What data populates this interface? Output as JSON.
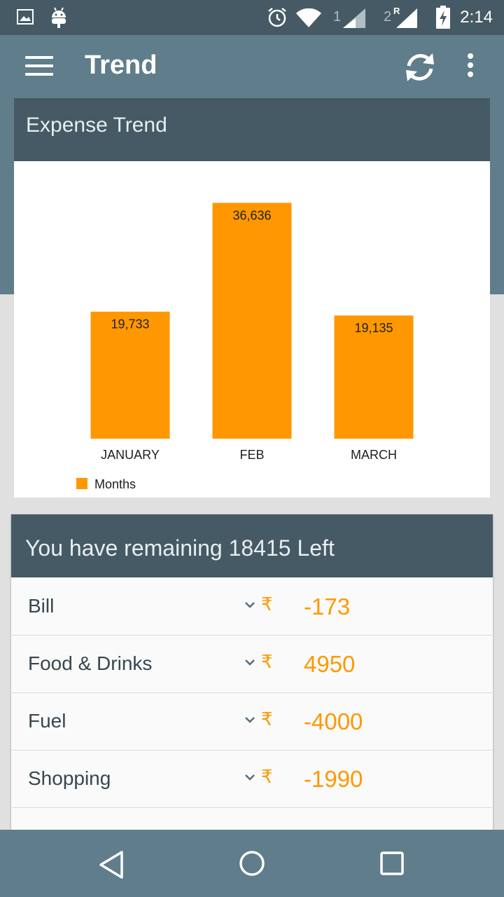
{
  "status_bar": {
    "time": "2:14",
    "sim1_label": "1",
    "sim2_label": "2",
    "sim2_roaming": "R",
    "icons": [
      "image-icon",
      "android-icon",
      "alarm-icon",
      "wifi-icon",
      "signal-icon",
      "signal-icon",
      "battery-charging-icon"
    ]
  },
  "app_bar": {
    "title": "Trend",
    "menu_icon": "hamburger-menu-icon",
    "refresh_icon": "refresh-icon",
    "more_icon": "more-vert-icon"
  },
  "trend_card": {
    "title": "Expense Trend"
  },
  "chart_data": {
    "type": "bar",
    "categories": [
      "JANUARY",
      "FEB",
      "MARCH"
    ],
    "values": [
      19733,
      36636,
      19135
    ],
    "value_labels": [
      "19,733",
      "36,636",
      "19,135"
    ],
    "series": [
      {
        "name": "Months",
        "values": [
          19733,
          36636,
          19135
        ]
      }
    ],
    "legend": "bottom-left",
    "grid": false,
    "ylim": [
      0,
      40500
    ],
    "color": "#ff9800"
  },
  "budget_card": {
    "title": "You have remaining 18415 Left",
    "currency": "₹",
    "rows": [
      {
        "label": "Bill",
        "value": "-173"
      },
      {
        "label": "Food & Drinks",
        "value": "4950"
      },
      {
        "label": "Fuel",
        "value": "-4000"
      },
      {
        "label": "Shopping",
        "value": "-1990"
      }
    ]
  },
  "colors": {
    "primary": "#607d8b",
    "primary_dark": "#455a64",
    "accent": "#ff9800"
  },
  "nav_bar": {
    "icons": [
      "back-icon",
      "home-icon",
      "recents-icon"
    ]
  }
}
